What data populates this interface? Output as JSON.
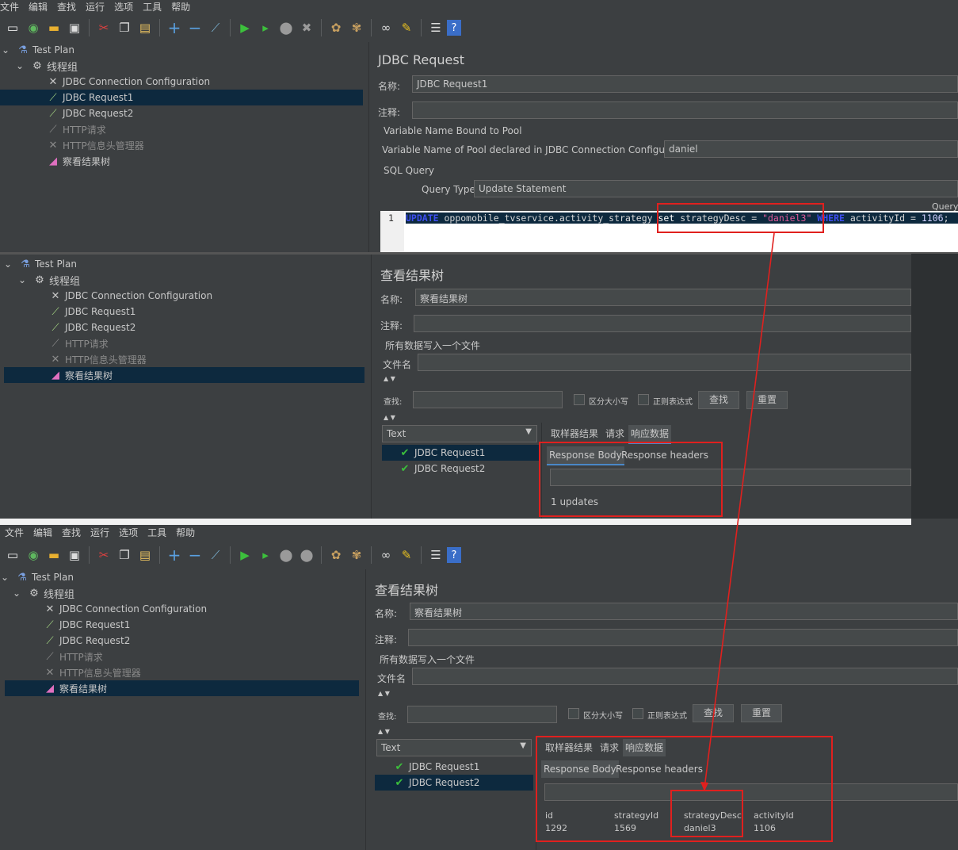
{
  "menu": [
    "文件",
    "编辑",
    "查找",
    "运行",
    "选项",
    "工具",
    "帮助"
  ],
  "toolbar_icons": [
    "new-icon",
    "templates-icon",
    "open-icon",
    "save-icon",
    "cut-icon",
    "copy-icon",
    "paste-icon",
    "expand-icon",
    "collapse-icon",
    "toggle-icon",
    "start-icon",
    "start-no-pause-icon",
    "stop-icon",
    "shutdown-icon",
    "clear-icon",
    "clear-all-icon",
    "search-icon",
    "reset-search-icon",
    "function-helper-icon",
    "help-icon"
  ],
  "tree": {
    "test_plan": "Test Plan",
    "thread_group": "线程组",
    "items": [
      "JDBC Connection Configuration",
      "JDBC Request1",
      "JDBC Request2",
      "HTTP请求",
      "HTTP信息头管理器",
      "察看结果树"
    ]
  },
  "jdbc_panel": {
    "title": "JDBC Request",
    "name_label": "名称:",
    "name_value": "JDBC Request1",
    "comment_label": "注释:",
    "var_bound_label": "Variable Name Bound to Pool",
    "var_pool_label": "Variable Name of Pool declared in JDBC Connection Configuration:",
    "var_pool_value": "daniel",
    "sql_query_label": "SQL Query",
    "query_type_label": "Query Type:",
    "query_type_value": "Update Statement",
    "query_right_label": "Query",
    "line_number": "1",
    "sql": {
      "kw_update": "UPDATE",
      "table": " oppomobile_tvservice.activity_strategy ",
      "kw_set": "set",
      "assign": " strategyDesc = ",
      "value": "\"daniel3\"",
      "kw_where": " WHERE",
      "cond": " activityId = ",
      "id": "1106",
      "end": ";"
    }
  },
  "results_panel": {
    "title": "查看结果树",
    "name_label": "名称:",
    "name_value": "察看结果树",
    "comment_label": "注释:",
    "file_group_label": "所有数据写入一个文件",
    "filename_label": "文件名",
    "search_label": "查找:",
    "case_label": "区分大小写",
    "regex_label": "正则表达式",
    "find_button": "查找",
    "reset_button": "重置",
    "render_select": "Text",
    "tab_sampler": "取样器结果",
    "tab_request": "请求",
    "tab_response": "响应数据",
    "subtab_body": "Response Body",
    "subtab_headers": "Response headers"
  },
  "result1": {
    "samples": [
      "JDBC Request1",
      "JDBC Request2"
    ],
    "body_text": "1 updates"
  },
  "result2": {
    "samples": [
      "JDBC Request1",
      "JDBC Request2"
    ],
    "columns": [
      "id",
      "strategyId",
      "strategyDesc",
      "activityId"
    ],
    "row": [
      "1292",
      "1569",
      "daniel3",
      "1106"
    ]
  },
  "colors": {
    "background": "#3c3f41",
    "selection": "#0d293e",
    "annotation_red": "#e0201e",
    "sql_keyword": "#3e4ef0",
    "sql_string": "#e05a9a"
  }
}
